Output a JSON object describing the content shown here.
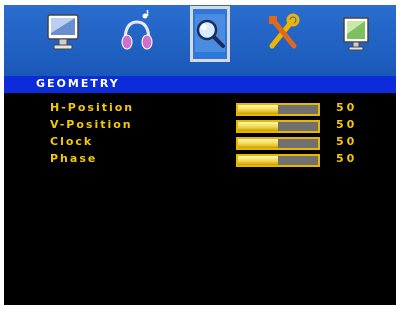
{
  "tabs": [
    {
      "icon": "monitor-icon",
      "selected": false
    },
    {
      "icon": "headphones-icon",
      "selected": false
    },
    {
      "icon": "magnifier-icon",
      "selected": true
    },
    {
      "icon": "tools-icon",
      "selected": false
    },
    {
      "icon": "display-settings-icon",
      "selected": false
    }
  ],
  "section": {
    "title": "GEOMETRY"
  },
  "settings": [
    {
      "label": "H-Position",
      "value": "50",
      "fraction": 0.5
    },
    {
      "label": "V-Position",
      "value": "50",
      "fraction": 0.5
    },
    {
      "label": "Clock",
      "value": "50",
      "fraction": 0.5
    },
    {
      "label": "Phase",
      "value": "50",
      "fraction": 0.5
    }
  ],
  "colors": {
    "tab_bar": "#1f62c4",
    "header": "#0c2cd9",
    "label": "#f5c800",
    "bar_fill": "#f4d64a",
    "bar_track": "#707070",
    "background": "#000000"
  }
}
